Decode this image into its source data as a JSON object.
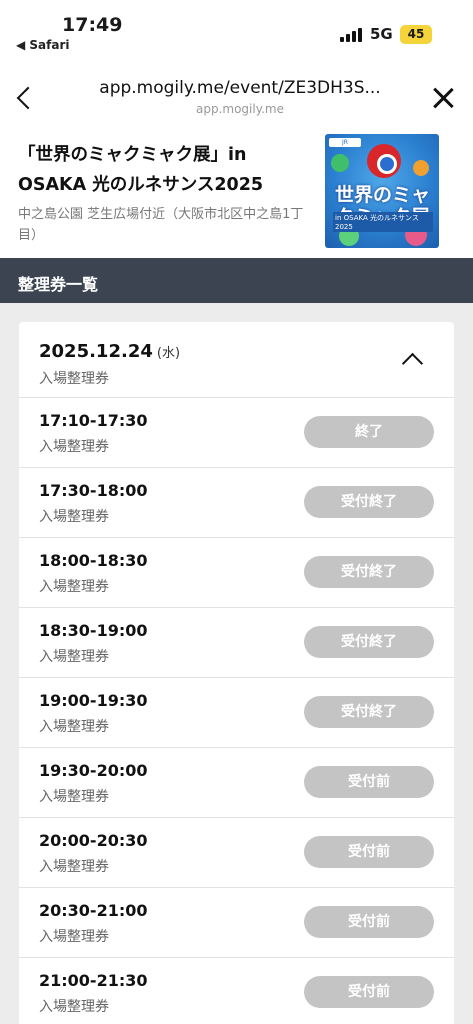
{
  "status_bar": {
    "time": "17:49",
    "back_app": "◀ Safari",
    "network": "5G",
    "battery": "45"
  },
  "url_bar": {
    "url": "app.mogily.me/event/ZE3DH3S...",
    "domain": "app.mogily.me"
  },
  "event": {
    "title": "「世界のミャクミャク展」in OSAKA 光のルネサンス2025",
    "venue": "中之島公園 芝生広場付近（大阪市北区中之島1丁目）",
    "thumbnail": {
      "badge": "JR",
      "title": "世界のミャクミャク展",
      "subtitle": "in OSAKA 光のルネサンス2025"
    }
  },
  "section": {
    "title": "整理券一覧"
  },
  "date_group": {
    "date": "2025.12.24",
    "weekday": "(水)",
    "ticket_type": "入場整理券"
  },
  "slots": [
    {
      "time": "17:10-17:30",
      "label": "入場整理券",
      "status": "終了"
    },
    {
      "time": "17:30-18:00",
      "label": "入場整理券",
      "status": "受付終了"
    },
    {
      "time": "18:00-18:30",
      "label": "入場整理券",
      "status": "受付終了"
    },
    {
      "time": "18:30-19:00",
      "label": "入場整理券",
      "status": "受付終了"
    },
    {
      "time": "19:00-19:30",
      "label": "入場整理券",
      "status": "受付終了"
    },
    {
      "time": "19:30-20:00",
      "label": "入場整理券",
      "status": "受付前"
    },
    {
      "time": "20:00-20:30",
      "label": "入場整理券",
      "status": "受付前"
    },
    {
      "time": "20:30-21:00",
      "label": "入場整理券",
      "status": "受付前"
    },
    {
      "time": "21:00-21:30",
      "label": "入場整理券",
      "status": "受付前"
    }
  ],
  "colors": {
    "section_header": "#3b4450",
    "disabled_button": "#c4c4c4",
    "battery": "#f5d33a"
  }
}
